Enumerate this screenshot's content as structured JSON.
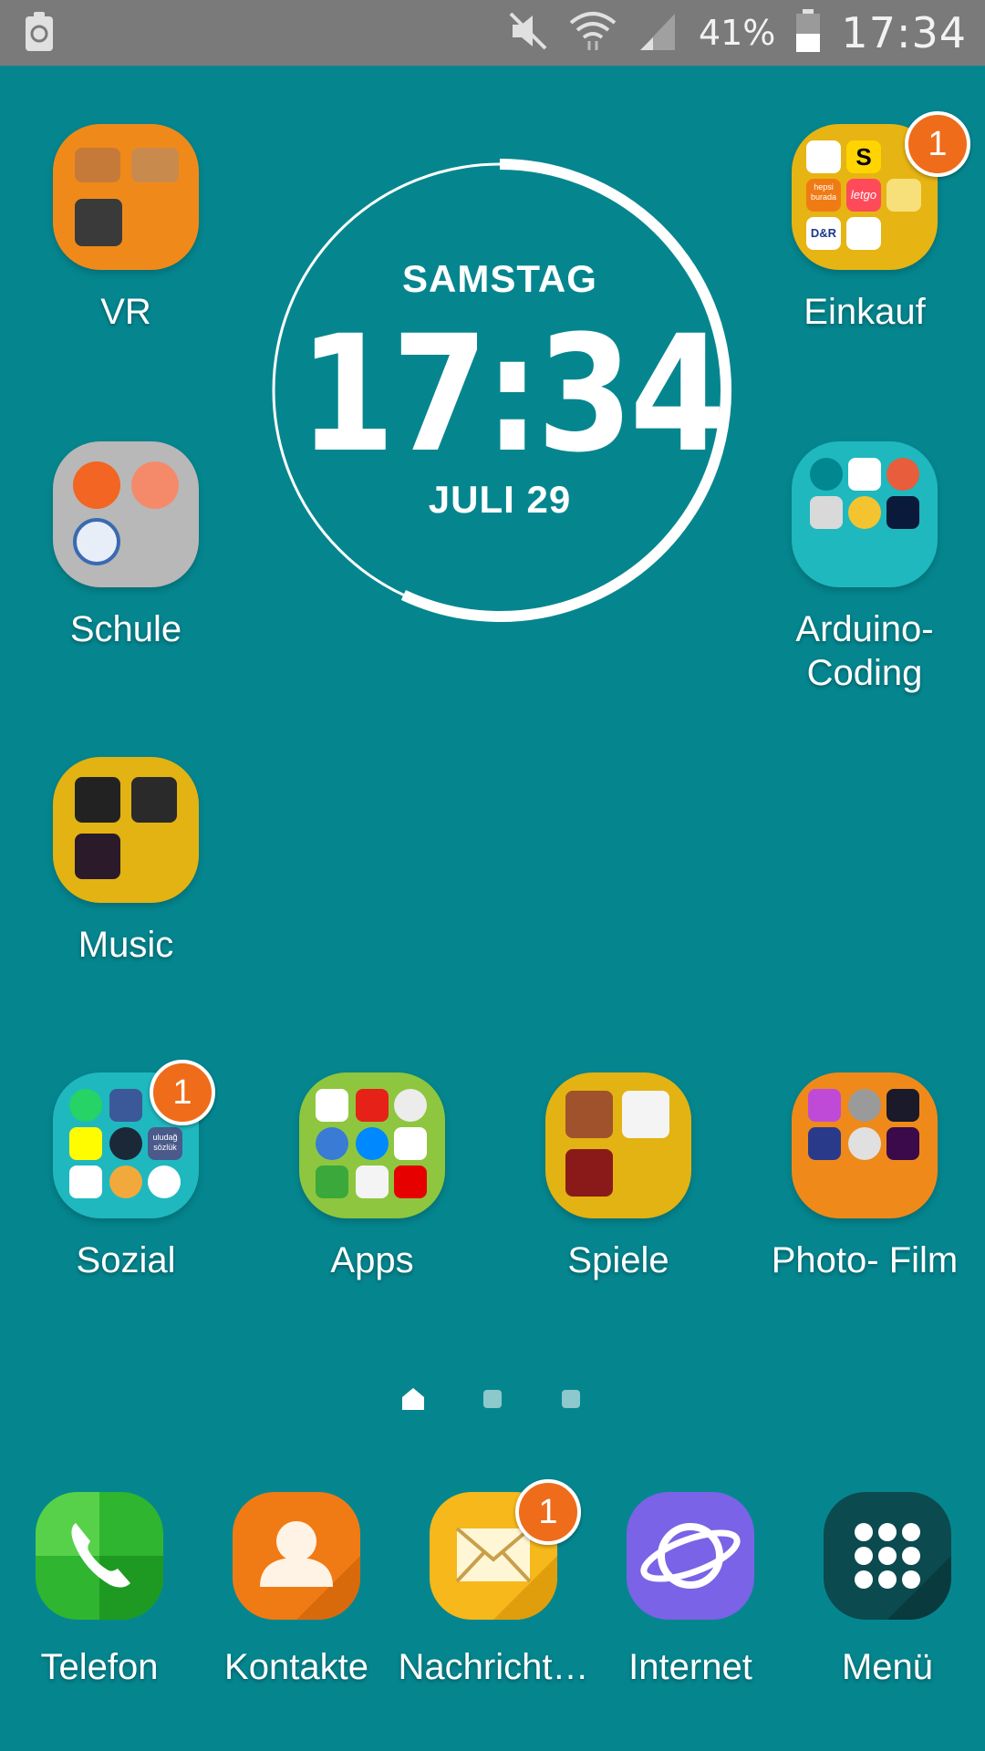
{
  "status_bar": {
    "battery_percent": "41%",
    "time": "17:34",
    "icons": [
      "recycle-icon",
      "mute-icon",
      "wifi-icon",
      "signal-icon",
      "battery-icon"
    ]
  },
  "clock_widget": {
    "day": "SAMSTAG",
    "time": "17:34",
    "date": "JULI 29",
    "seconds_progress": 0.57
  },
  "folders": [
    {
      "label": "VR",
      "color": "#ef8a1a"
    },
    {
      "label": "Einkauf",
      "color": "#e6b413",
      "badge": "1"
    },
    {
      "label": "Schule",
      "color": "#b8b8b8"
    },
    {
      "label": "Arduino-\nCoding",
      "line1": "Arduino-",
      "line2": "Coding",
      "color": "#1fb8bf"
    },
    {
      "label": "Music",
      "color": "#e2b312"
    },
    {
      "label": "Sozial",
      "color": "#1fb8bf",
      "badge": "1"
    },
    {
      "label": "Apps",
      "color": "#8ec63f"
    },
    {
      "label": "Spiele",
      "color": "#e2b312"
    },
    {
      "label": "Photo- Film",
      "color": "#ef8a1a"
    }
  ],
  "einkauf_mini": [
    "hepsi burada",
    "letgo",
    "D&R",
    "S"
  ],
  "sozial_mini": [
    "uludağ sözlük"
  ],
  "dock": [
    {
      "label": "Telefon",
      "color": "#2fb52f"
    },
    {
      "label": "Kontakte",
      "color": "#f07b14"
    },
    {
      "label": "Nachricht…",
      "color": "#f6b81b",
      "badge": "1"
    },
    {
      "label": "Internet",
      "color": "#7a63e6"
    },
    {
      "label": "Menü",
      "color": "#0b4a4f"
    }
  ],
  "pager": {
    "pages": 3,
    "current": 1
  }
}
